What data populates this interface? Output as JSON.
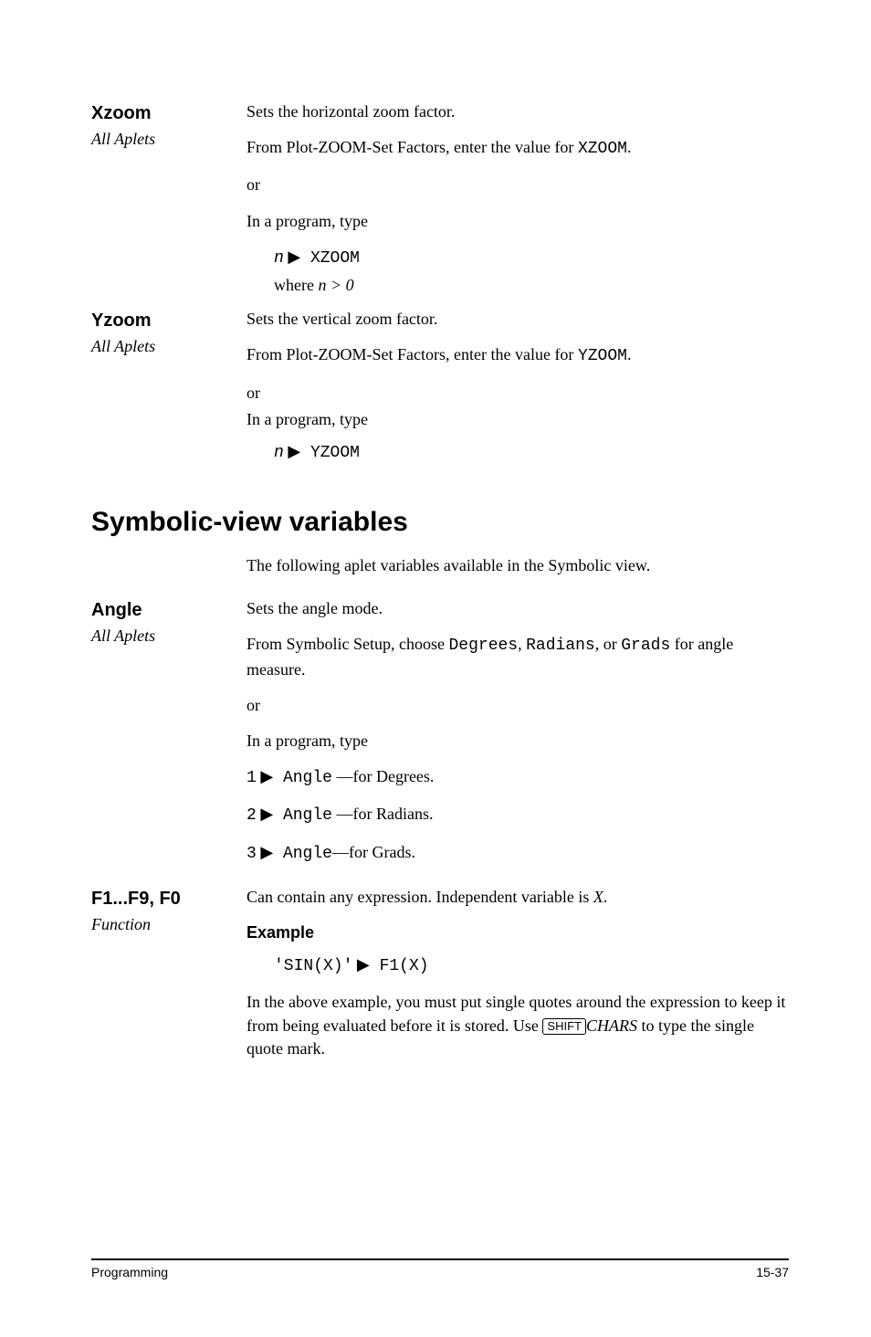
{
  "xzoom": {
    "title": "Xzoom",
    "sub": "All Aplets",
    "p1": "Sets the horizontal zoom factor.",
    "p2_pre": "From Plot-ZOOM-Set Factors, enter the value for ",
    "p2_code": "XZOOM",
    "p2_post": ".",
    "or": "or",
    "p3": "In a program, type",
    "code_n": "n",
    "code_cmd": " XZOOM",
    "where_pre": "where ",
    "where_expr": "n > 0"
  },
  "yzoom": {
    "title": "Yzoom",
    "sub": "All Aplets",
    "p1": "Sets the vertical zoom factor.",
    "p2_pre": "From Plot-ZOOM-Set Factors, enter the value for ",
    "p2_code": "YZOOM",
    "p2_post": ".",
    "or": "or",
    "p3": "In a program, type",
    "code_n": "n",
    "code_cmd": " YZOOM"
  },
  "section": {
    "heading": "Symbolic-view variables",
    "intro": "The following aplet variables available in the Symbolic view."
  },
  "angle": {
    "title": "Angle",
    "sub": "All Aplets",
    "p1": "Sets the angle mode.",
    "p2_pre": "From Symbolic Setup, choose ",
    "p2_c1": "Degrees",
    "p2_mid1": ", ",
    "p2_c2": "Radians",
    "p2_mid2": ", or ",
    "p2_c3": "Grads",
    "p2_post": " for angle measure.",
    "or": "or",
    "p3": "In a program, type",
    "l1_n": "1",
    "l1_cmd": " Angle",
    "l1_rest": " —for Degrees.",
    "l2_n": "2",
    "l2_cmd": " Angle",
    "l2_rest": " —for Radians.",
    "l3_n": "3",
    "l3_cmd": " Angle",
    "l3_rest": "—for Grads."
  },
  "fvars": {
    "title": "F1...F9, F0",
    "sub": "Function",
    "p1_pre": "Can contain any expression. Independent variable is ",
    "p1_var": "X",
    "p1_post": ".",
    "example": "Example",
    "code_left": "'SIN(X)'",
    "code_right": " F1(X)",
    "p2a": "In the above example, you must put single quotes around the expression to keep it from being evaluated before it is stored. Use ",
    "key": "SHIFT",
    "chars": "CHARS",
    "p2b": " to type the single quote mark."
  },
  "footer": {
    "left": "Programming",
    "right": "15-37"
  }
}
